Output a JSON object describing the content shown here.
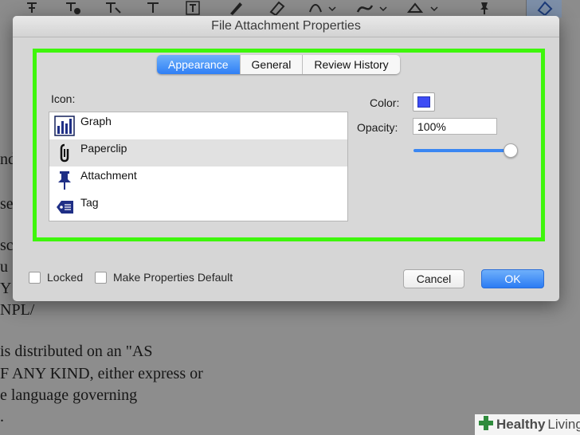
{
  "toolbar": {
    "icons": [
      "text-cursor-icon",
      "stamp-icon",
      "text-insert-icon",
      "text-replace-icon",
      "text-box-icon",
      "pencil-icon",
      "eraser-icon",
      "shape-icon",
      "signature-icon",
      "stamp-tool-icon",
      "pin-icon",
      "attach-tool-icon"
    ]
  },
  "document": {
    "lines": [
      "nd",
      "se",
      "sc",
      "u",
      "Y",
      "NPL/",
      "is distributed on an \"AS",
      "F ANY KIND, either express or",
      "e language governing",
      "."
    ]
  },
  "dialog": {
    "title": "File Attachment Properties",
    "tabs": [
      {
        "label": "Appearance",
        "active": true
      },
      {
        "label": "General",
        "active": false
      },
      {
        "label": "Review History",
        "active": false
      }
    ],
    "icon_label": "Icon:",
    "icons": [
      {
        "label": "Graph",
        "icon": "graph-icon",
        "selected": false
      },
      {
        "label": "Paperclip",
        "icon": "paperclip-icon",
        "selected": true
      },
      {
        "label": "Attachment",
        "icon": "pushpin-icon",
        "selected": false
      },
      {
        "label": "Tag",
        "icon": "tag-icon",
        "selected": false
      }
    ],
    "color_label": "Color:",
    "color_value": "#3d4cf5",
    "opacity_label": "Opacity:",
    "opacity_value": "100%",
    "opacity_level": 1.0,
    "locked_label": "Locked",
    "locked_checked": false,
    "make_default_label": "Make Properties Default",
    "make_default_checked": false,
    "cancel_label": "Cancel",
    "ok_label": "OK"
  },
  "colors": {
    "highlight_frame": "#3ef60c",
    "accent_blue": "#2f7ff5"
  },
  "watermark": {
    "brand_bold": "Healthy",
    "brand_light": "Living"
  }
}
